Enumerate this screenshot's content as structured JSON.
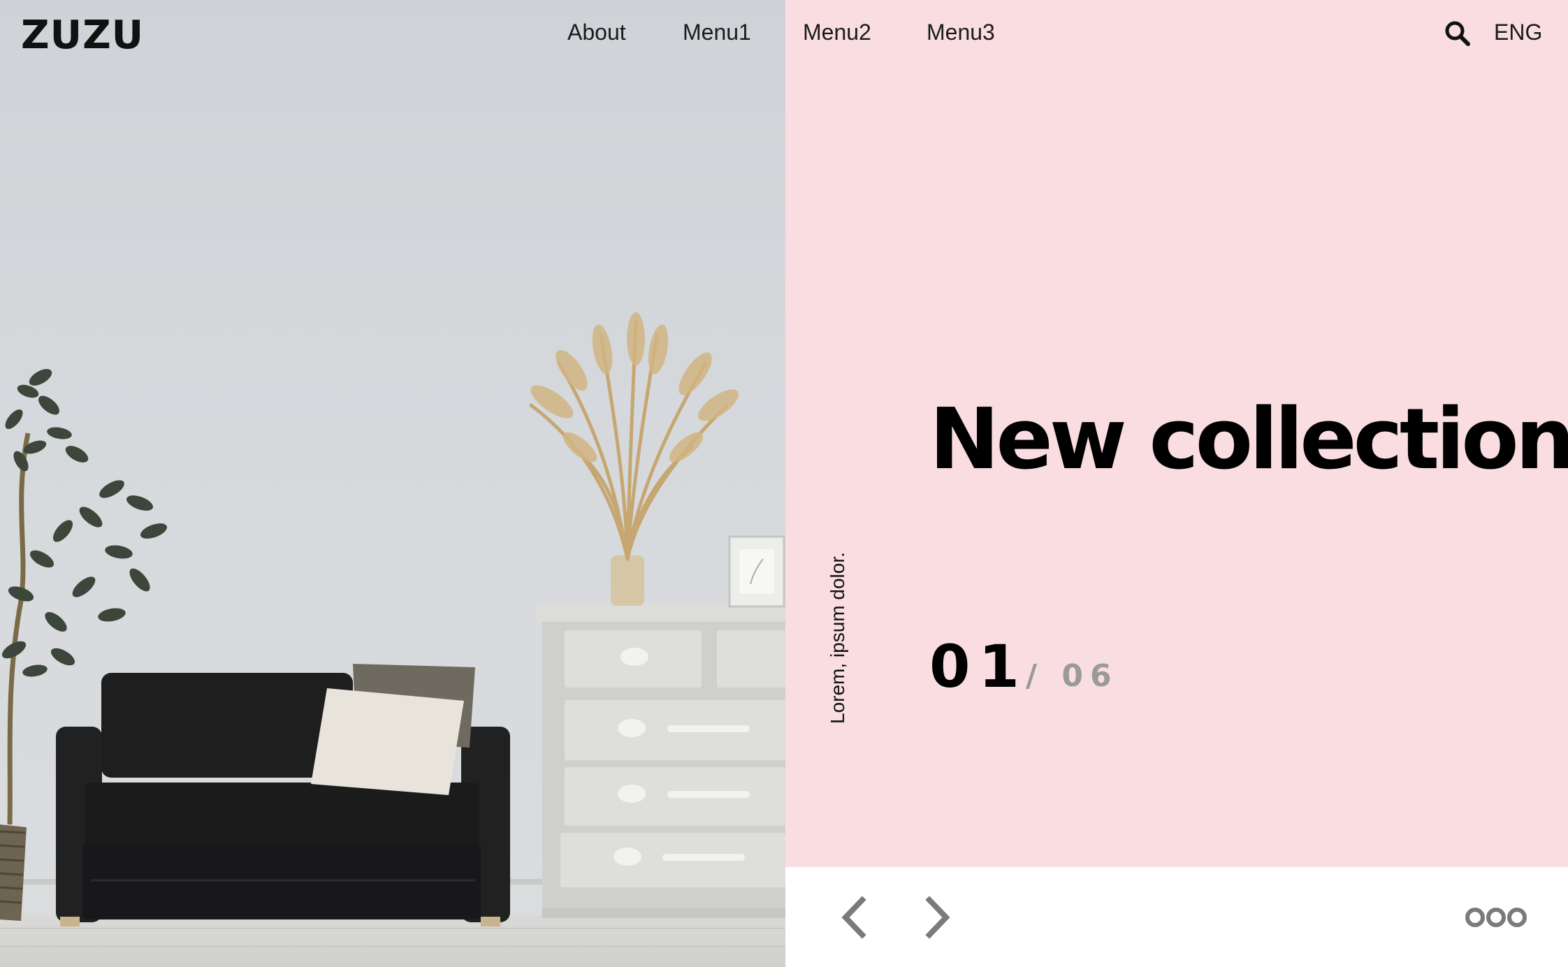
{
  "header": {
    "logo": "ZUZU",
    "nav": [
      "About",
      "Menu1",
      "Menu2",
      "Menu3"
    ],
    "search_icon": "search-icon",
    "language": "ENG"
  },
  "hero": {
    "image_description_icon": "interior-photo",
    "headline": "New collection",
    "vertical_caption": "Lorem, ipsum dolor.",
    "slide_current": "01",
    "slide_total": "/ 06"
  },
  "controls": {
    "prev_icon": "chevron-left-icon",
    "next_icon": "chevron-right-icon",
    "more_icon": "more-dots-icon"
  },
  "colors": {
    "pink": "#f9dde0",
    "text": "#000000",
    "muted": "#9a9a9a",
    "icon": "#7a7a7a"
  }
}
